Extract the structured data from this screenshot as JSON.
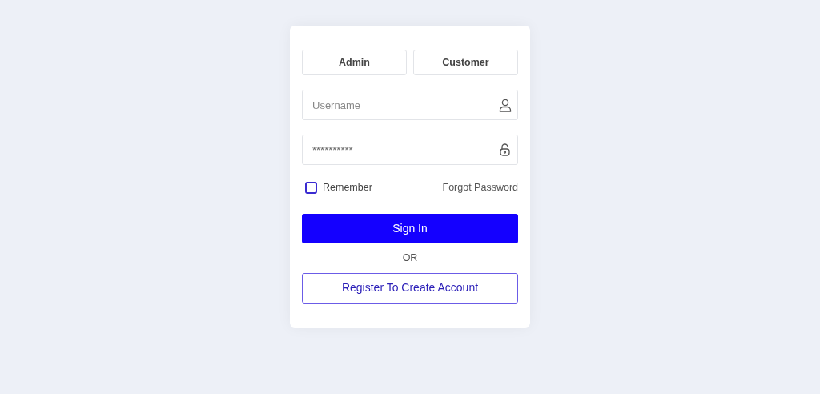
{
  "tabs": [
    {
      "label": "Admin",
      "selected": false
    },
    {
      "label": "Customer",
      "selected": false
    }
  ],
  "username": {
    "placeholder": "Username"
  },
  "password": {
    "value": "**********"
  },
  "remember": {
    "label": "Remember",
    "checked": false
  },
  "forgot_link": "Forgot Password",
  "sign_in_button": "Sign In",
  "divider_text": "OR",
  "register_button": "Register To Create Account"
}
